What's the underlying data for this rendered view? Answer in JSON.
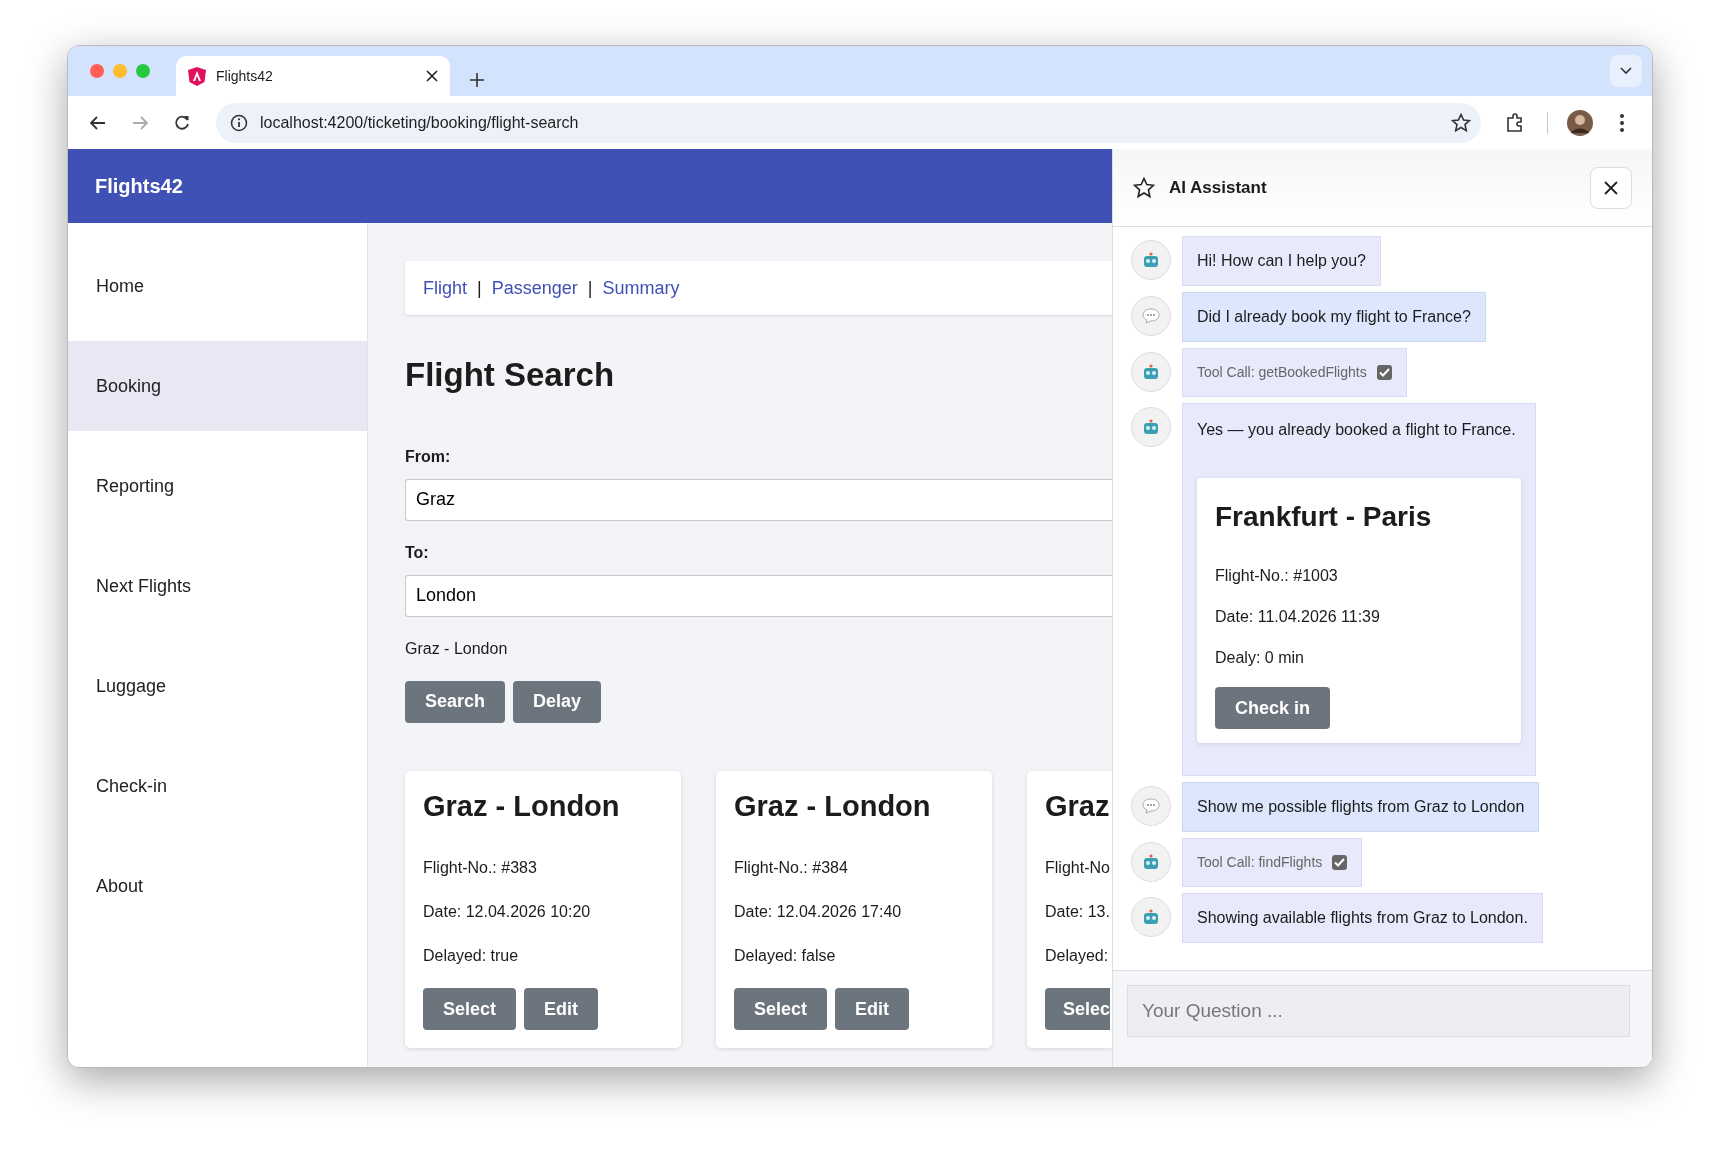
{
  "browser": {
    "tab_title": "Flights42",
    "url": "localhost:4200/ticketing/booking/flight-search"
  },
  "app": {
    "brand": "Flights42"
  },
  "sidebar": {
    "items": [
      {
        "label": "Home",
        "selected": false
      },
      {
        "label": "Booking",
        "selected": true
      },
      {
        "label": "Reporting",
        "selected": false
      },
      {
        "label": "Next Flights",
        "selected": false
      },
      {
        "label": "Luggage",
        "selected": false
      },
      {
        "label": "Check-in",
        "selected": false
      },
      {
        "label": "About",
        "selected": false
      }
    ]
  },
  "breadcrumb": [
    {
      "kind": "link",
      "label": "Flight"
    },
    {
      "kind": "separator",
      "label": "|"
    },
    {
      "kind": "link",
      "label": "Passenger"
    },
    {
      "kind": "separator",
      "label": "|"
    },
    {
      "kind": "link",
      "label": "Summary"
    }
  ],
  "search": {
    "title": "Flight Search",
    "fields": [
      {
        "label": "From:",
        "value": "Graz"
      },
      {
        "label": "To:",
        "value": "London"
      }
    ],
    "route": "Graz - London",
    "buttons": [
      "Search",
      "Delay"
    ]
  },
  "flights": [
    {
      "title": "Graz - London",
      "number": "Flight-No.: #383",
      "date": "Date: 12.04.2026 10:20",
      "delayed": "Delayed: true",
      "buttons": [
        "Select",
        "Edit"
      ]
    },
    {
      "title": "Graz - London",
      "number": "Flight-No.: #384",
      "date": "Date: 12.04.2026 17:40",
      "delayed": "Delayed: false",
      "buttons": [
        "Select",
        "Edit"
      ]
    },
    {
      "title": "Graz",
      "number": "Flight-No",
      "date": "Date: 13.",
      "delayed": "Delayed:",
      "buttons": [
        "Selec"
      ]
    }
  ],
  "assistant": {
    "title": "AI Assistant",
    "messages": [
      {
        "from_user": false,
        "kind": "text",
        "text": "Hi! How can I help you?"
      },
      {
        "from_user": true,
        "kind": "text",
        "text": "Did I already book my flight to France?"
      },
      {
        "from_user": false,
        "kind": "tool_call",
        "text": "Tool Call: getBookedFlights",
        "checked": true
      },
      {
        "from_user": false,
        "kind": "card",
        "text": "Yes — you already booked a flight to France.",
        "card": {
          "title": "Frankfurt - Paris",
          "lines": [
            "Flight-No.: #1003",
            "Date: 11.04.2026 11:39",
            "Dealy: 0 min"
          ],
          "button": "Check in"
        }
      },
      {
        "from_user": true,
        "kind": "text",
        "text": "Show me possible flights from Graz to London"
      },
      {
        "from_user": false,
        "kind": "tool_call",
        "text": "Tool Call: findFlights",
        "checked": true
      },
      {
        "from_user": false,
        "kind": "text",
        "text": "Showing available flights from Graz to London."
      }
    ],
    "input": {
      "placeholder": "Your Question ..."
    }
  }
}
